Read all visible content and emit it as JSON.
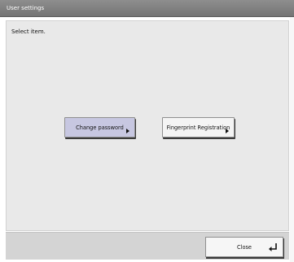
{
  "window": {
    "title": "User settings"
  },
  "main": {
    "instruction": "Select item.",
    "buttons": [
      {
        "label": "Change password",
        "icon": "triangle-right-icon"
      },
      {
        "label": "Fingerprint Registration",
        "icon": "triangle-right-icon"
      }
    ]
  },
  "footer": {
    "close_label": "Close",
    "close_icon": "enter-return-icon"
  },
  "colors": {
    "titlebar": "#808080",
    "content_bg": "#e9e9e9",
    "selected_button": "#c7c7e1",
    "footer_bg": "#d4d4d4"
  }
}
